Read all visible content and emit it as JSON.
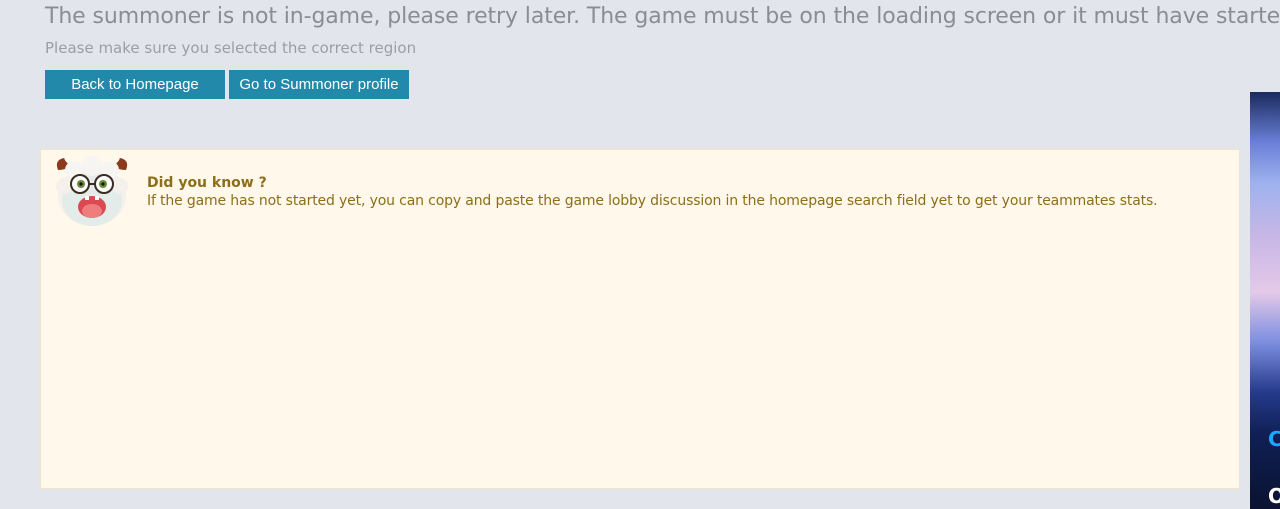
{
  "message": {
    "headline": "The summoner is not in-game, please retry later. The game must be on the loading screen or it must have started.",
    "hint": "Please make sure you selected the correct region"
  },
  "buttons": {
    "home_label": "Back to Homepage",
    "profile_label": "Go to Summoner profile"
  },
  "tip": {
    "title": "Did you know ?",
    "text": "If the game has not started yet, you can copy and paste the game lobby discussion in the homepage search field yet to get your teammates stats.",
    "mascot_icon": "poro-mascot-icon"
  },
  "ad": {
    "letter_1": "C",
    "letter_2": "O"
  },
  "colors": {
    "background": "#e2e5ec",
    "button": "#2389ab",
    "tip_background": "#fff8eb",
    "tip_text": "#8d6e19"
  }
}
